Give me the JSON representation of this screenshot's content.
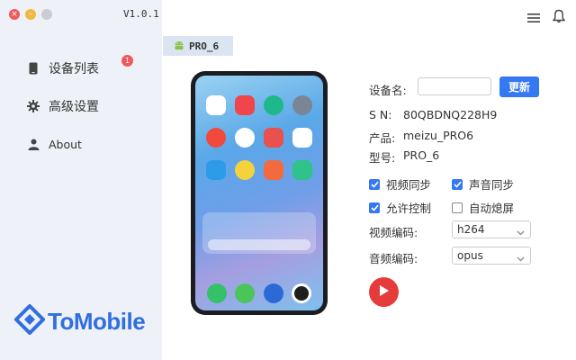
{
  "window": {
    "version": "V1.0.1"
  },
  "sidebar": {
    "items": [
      {
        "label": "设备列表",
        "icon": "phone-icon",
        "badge": "1"
      },
      {
        "label": "高级设置",
        "icon": "gear-icon"
      },
      {
        "label": "About",
        "icon": "user-icon"
      }
    ],
    "logo_text": "ToMobile"
  },
  "header": {
    "menu_icon": "hamburger-menu-icon",
    "bell_icon": "bell-icon"
  },
  "device_tab": {
    "label": "PRO_6",
    "icon": "android-icon"
  },
  "device_form": {
    "name_label": "设备名:",
    "name_value": "",
    "refresh_label": "更新",
    "sn_label": "S  N:",
    "sn_value": "80QBDNQ228H9",
    "product_label": "产品:",
    "product_value": "meizu_PRO6",
    "model_label": "型号:",
    "model_value": "PRO_6",
    "options": {
      "video_sync": {
        "label": "视频同步",
        "checked": true
      },
      "audio_sync": {
        "label": "声音同步",
        "checked": true
      },
      "allow_control": {
        "label": "允许控制",
        "checked": true
      },
      "auto_screen_off": {
        "label": "自动熄屏",
        "checked": false
      }
    },
    "video_codec_label": "视频编码:",
    "video_codec_value": "h264",
    "audio_codec_label": "音频编码:",
    "audio_codec_value": "opus",
    "play_icon": "play-icon"
  },
  "colors": {
    "accent": "#3478f2",
    "play_button": "#e53b3b",
    "sidebar_bg": "#eef1f7",
    "badge": "#f05a5a",
    "logo": "#2f6fe0"
  }
}
